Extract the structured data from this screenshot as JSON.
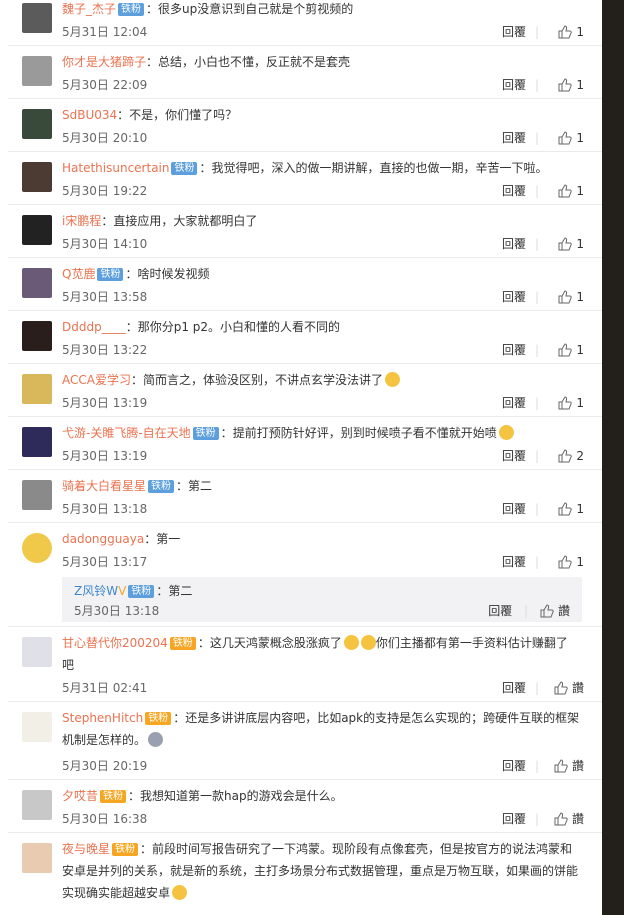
{
  "comments": [
    {
      "user": "魏子_杰子",
      "badge": "铁粉",
      "text": "很多up没意识到自己就是个剪视频的",
      "time": "5月31日 12:04",
      "reply": "回覆",
      "likes": "1"
    },
    {
      "user": "你才是大猪蹄子",
      "badge": "",
      "text": "总结，小白也不懂，反正就不是套壳",
      "time": "5月30日 22:09",
      "reply": "回覆",
      "likes": "1"
    },
    {
      "user": "SdBU034",
      "badge": "",
      "text": "不是，你们懂了吗？",
      "time": "5月30日 20:10",
      "reply": "回覆",
      "likes": "1"
    },
    {
      "user": "Hatethisuncertain",
      "badge": "铁粉",
      "text": "我觉得吧，深入的做一期讲解，直接的也做一期，辛苦一下啦。",
      "time": "5月30日 19:22",
      "reply": "回覆",
      "likes": "1"
    },
    {
      "user": "i宋鹏程",
      "badge": "",
      "text": "直接应用，大家就都明白了",
      "time": "5月30日 14:10",
      "reply": "回覆",
      "likes": "1"
    },
    {
      "user": "Q苋鹿",
      "badge": "铁粉",
      "text": "啥时候发视频",
      "time": "5月30日 13:58",
      "reply": "回覆",
      "likes": "1"
    },
    {
      "user": "Ddddp____",
      "badge": "",
      "text": "那你分p1 p2。小白和懂的人看不同的",
      "time": "5月30日 13:22",
      "reply": "回覆",
      "likes": "1"
    },
    {
      "user": "ACCA爱学习",
      "badge": "",
      "text": "简而言之，体验没区别，不讲点玄学没法讲了",
      "time": "5月30日 13:19",
      "reply": "回覆",
      "likes": "1"
    },
    {
      "user": "弋游-关睢飞腾-自在天地",
      "badge": "铁粉",
      "text": "提前打预防针好评，别到时候喷子看不懂就开始喷",
      "time": "5月30日 13:19",
      "reply": "回覆",
      "likes": "2"
    },
    {
      "user": "骑着大白看星星",
      "badge": "铁粉",
      "text": "第二",
      "time": "5月30日 13:18",
      "reply": "回覆",
      "likes": "1"
    },
    {
      "user": "dadongguaya",
      "badge": "",
      "text": "第一",
      "time": "5月30日 13:17",
      "reply": "回覆",
      "likes": "1"
    }
  ],
  "nested_reply": {
    "user": "Z风铃W",
    "badge": "铁粉",
    "text": "第二",
    "time": "5月30日 13:18",
    "reply": "回覆",
    "like_label": "讚"
  },
  "comments2": [
    {
      "user": "甘心替代你200204",
      "badge": "铁粉",
      "text1": "这几天鸿蒙概念股涨疯了",
      "text2": "你们主播都有第一手资料估计赚翻了",
      "text3": "吧",
      "time": "5月31日 02:41",
      "reply": "回覆",
      "like_label": "讚"
    },
    {
      "user": "StephenHitch",
      "badge": "铁粉",
      "text1": "还是多讲讲底层内容吧，比如apk的支持是怎么实现的；跨硬件互联的框架",
      "text2": "机制是怎样的。",
      "time": "5月30日 20:19",
      "reply": "回覆",
      "like_label": "讚"
    },
    {
      "user": "夕哎昔",
      "badge": "铁粉",
      "text1": "我想知道第一款hap的游戏会是什么。",
      "time": "5月30日 16:38",
      "reply": "回覆",
      "like_label": "讚"
    },
    {
      "user": "夜与晚星",
      "badge": "铁粉",
      "text1": "前段时间写报告研究了一下鸿蒙。现阶段有点像套壳，但是按官方的说法鸿蒙和",
      "text2": "安卓是并列的关系，就是新的系统，主打多场景分布式数据管理，重点是万物互联，如果画的饼能",
      "text3": "实现确实能超越安卓"
    }
  ],
  "colors": {
    "username": "#eb7350",
    "username_blue": "#3c87cd",
    "badge": "#5c9fdc",
    "badge_gold": "#f6a623",
    "frame": "#231f1b"
  }
}
